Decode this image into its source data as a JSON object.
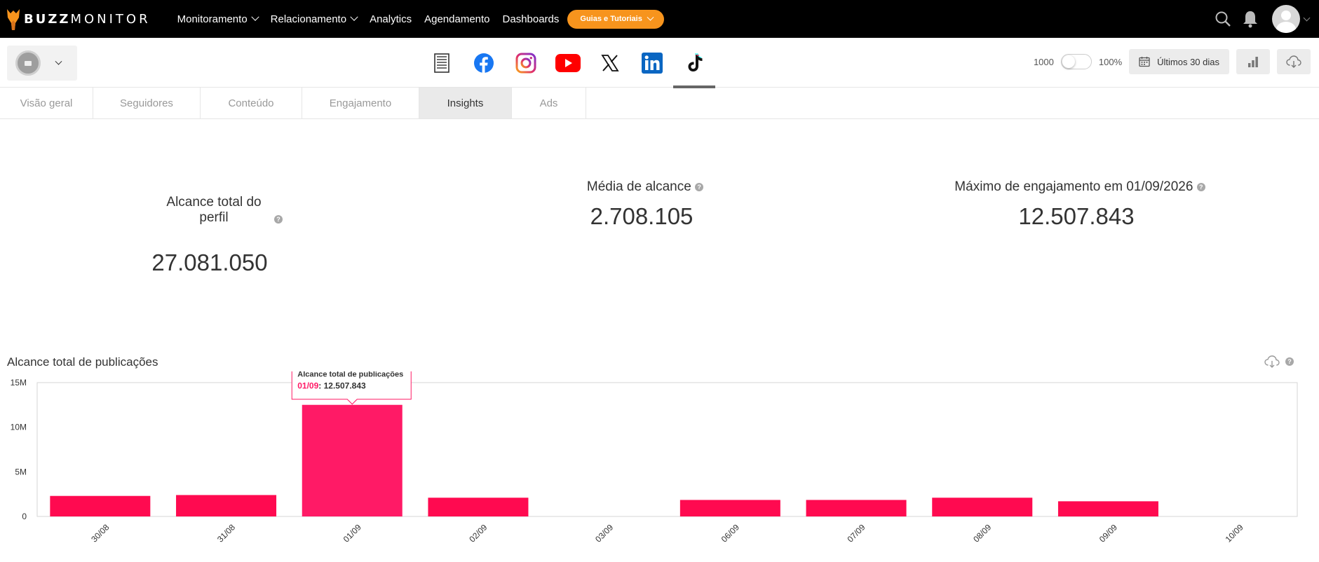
{
  "brand": {
    "bold": "BUZZ",
    "thin": "MONITOR",
    "accent": "#f7941d"
  },
  "nav": {
    "items": [
      {
        "label": "Monitoramento",
        "dropdown": true
      },
      {
        "label": "Relacionamento",
        "dropdown": true
      },
      {
        "label": "Analytics",
        "dropdown": false
      },
      {
        "label": "Agendamento",
        "dropdown": false
      },
      {
        "label": "Dashboards",
        "dropdown": false
      }
    ],
    "guides_label": "Guias e Tutoriais"
  },
  "networks": [
    {
      "name": "document-icon"
    },
    {
      "name": "facebook-icon"
    },
    {
      "name": "instagram-icon"
    },
    {
      "name": "youtube-icon"
    },
    {
      "name": "x-icon"
    },
    {
      "name": "linkedin-icon"
    },
    {
      "name": "tiktok-icon",
      "active": true
    }
  ],
  "controls": {
    "left_label": "1000",
    "right_label": "100%",
    "date_range": "Últimos 30 dias"
  },
  "tabs": [
    {
      "label": "Visão geral"
    },
    {
      "label": "Seguidores"
    },
    {
      "label": "Conteúdo"
    },
    {
      "label": "Engajamento"
    },
    {
      "label": "Insights",
      "active": true
    },
    {
      "label": "Ads"
    }
  ],
  "metrics": {
    "total_reach": {
      "label_line1": "Alcance total do",
      "label_line2": "perfil",
      "value": "27.081.050"
    },
    "avg_reach": {
      "label": "Média de alcance",
      "value": "2.708.105"
    },
    "max_engagement": {
      "label": "Máximo de engajamento em 01/09/2026",
      "value": "12.507.843"
    },
    "help_glyph": "?"
  },
  "chart_data": {
    "type": "bar",
    "title": "Alcance total de publicações",
    "categories": [
      "30/08",
      "31/08",
      "01/09",
      "02/09",
      "03/09",
      "06/09",
      "07/09",
      "08/09",
      "09/09",
      "10/09"
    ],
    "values": [
      2300000,
      2400000,
      12507843,
      2100000,
      0,
      1850000,
      1850000,
      2100000,
      1700000,
      0
    ],
    "y_ticks": [
      "0",
      "5M",
      "10M",
      "15M"
    ],
    "ylim": [
      0,
      15000000
    ],
    "color": "#ff0a50",
    "highlight_color": "#ff1a66",
    "tooltip": {
      "title": "Alcance total de publicações",
      "date": "01/09",
      "value": "12.507.843",
      "index": 2
    }
  }
}
